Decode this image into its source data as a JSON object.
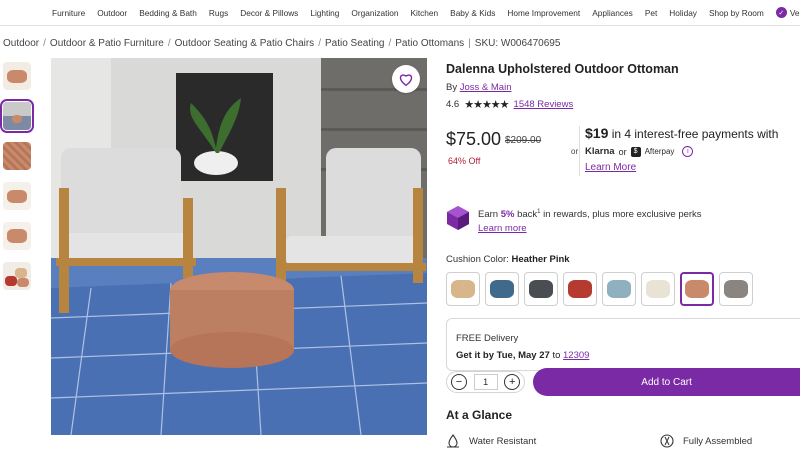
{
  "nav": {
    "items": [
      "Furniture",
      "Outdoor",
      "Bedding & Bath",
      "Rugs",
      "Decor & Pillows",
      "Lighting",
      "Organization",
      "Kitchen",
      "Baby & Kids",
      "Home Improvement",
      "Appliances",
      "Pet",
      "Holiday",
      "Shop by Room"
    ],
    "verified": "Verified"
  },
  "breadcrumb": {
    "items": [
      "Outdoor",
      "Outdoor & Patio Furniture",
      "Outdoor Seating & Patio Chairs",
      "Patio Seating",
      "Patio Ottomans"
    ],
    "sku": "SKU: W006470695"
  },
  "product": {
    "title": "Dalenna Upholstered Outdoor Ottoman",
    "by_prefix": "By",
    "brand": "Joss & Main",
    "rating": "4.6",
    "stars": "★★★★★",
    "reviews": "1548 Reviews"
  },
  "price": {
    "current": "$75.00",
    "was": "$209.00",
    "off": "64% Off",
    "or": "or",
    "installment_amount": "$19",
    "installment_text": "in 4 interest-free payments with",
    "klarna": "Klarna",
    "or2": "or",
    "afterpay": "Afterpay",
    "learn_more": "Learn More"
  },
  "rewards": {
    "earn": "Earn",
    "pct": "5%",
    "back": "back",
    "sup": "1",
    "rest": "in rewards, plus more exclusive perks",
    "learn_more": "Learn more"
  },
  "color": {
    "label": "Cushion Color:",
    "selected": "Heather Pink",
    "swatches": [
      "#d8b58a",
      "#3f6a8c",
      "#4a4d52",
      "#b53a30",
      "#8fb0bf",
      "#e9e3d6",
      "#c98a6b",
      "#8a8580"
    ]
  },
  "delivery": {
    "free": "FREE Delivery",
    "get_it": "Get it by Tue, May 27",
    "to": "to",
    "zip": "12309"
  },
  "cart": {
    "qty": "1",
    "minus": "−",
    "plus": "+",
    "add": "Add to Cart"
  },
  "glance": {
    "title": "At a Glance",
    "features": [
      "Water Resistant",
      "Fully Assembled"
    ]
  },
  "colors": {
    "accent": "#7b2aa5",
    "sale": "#b0203a"
  }
}
